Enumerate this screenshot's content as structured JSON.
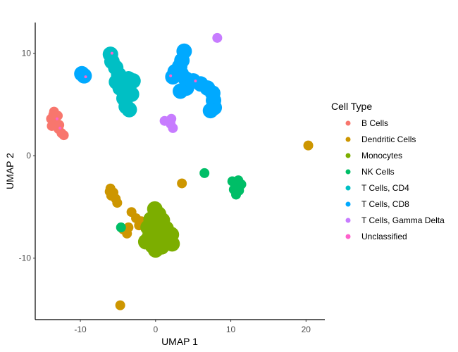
{
  "chart_data": {
    "type": "scatter",
    "title": "",
    "xlabel": "UMAP 1",
    "ylabel": "UMAP 2",
    "xlim": [
      -16,
      22.5
    ],
    "ylim": [
      -16,
      13
    ],
    "xticks": [
      -10,
      0,
      10,
      20
    ],
    "xtick_labels": [
      "-10",
      "0",
      "10",
      "20"
    ],
    "yticks": [
      -10,
      0,
      10
    ],
    "ytick_labels": [
      "-10",
      "0",
      "10"
    ],
    "grid": false,
    "legend": {
      "title": "Cell Type",
      "position": "right",
      "entries": [
        {
          "label": "B Cells",
          "color": "#F8766D"
        },
        {
          "label": "Dendritic Cells",
          "color": "#CD9600"
        },
        {
          "label": "Monocytes",
          "color": "#7CAE00"
        },
        {
          "label": "NK Cells",
          "color": "#00BE67"
        },
        {
          "label": "T Cells, CD4",
          "color": "#00BFC4"
        },
        {
          "label": "T Cells, CD8",
          "color": "#00A9FF"
        },
        {
          "label": "T Cells, Gamma Delta",
          "color": "#C77CFF"
        },
        {
          "label": "Unclassified",
          "color": "#FF61CC"
        }
      ]
    },
    "clusters": [
      {
        "name": "B Cells",
        "color": "#F8766D",
        "points": [
          [
            -13.5,
            4.3
          ],
          [
            -13.9,
            3.6
          ],
          [
            -13.2,
            3.2
          ],
          [
            -13.8,
            2.9
          ],
          [
            -12.9,
            2.6
          ],
          [
            -12.5,
            2.2
          ],
          [
            -12.2,
            2.0
          ],
          [
            -13.0,
            3.9
          ],
          [
            -13.6,
            4.0
          ],
          [
            -12.8,
            3.0
          ]
        ]
      },
      {
        "name": "Dendritic Cells",
        "color": "#CD9600",
        "points": [
          [
            -6.0,
            -3.2
          ],
          [
            -5.6,
            -3.6
          ],
          [
            -5.9,
            -3.9
          ],
          [
            -5.3,
            -4.2
          ],
          [
            -5.1,
            -4.6
          ],
          [
            -6.1,
            -3.5
          ],
          [
            -3.2,
            -5.5
          ],
          [
            -2.6,
            -6.1
          ],
          [
            -2.2,
            -6.8
          ],
          [
            -3.6,
            -7.0
          ],
          [
            -4.3,
            -7.2
          ],
          [
            -3.8,
            -7.6
          ],
          [
            -1.9,
            -6.4
          ],
          [
            -4.7,
            -14.6
          ],
          [
            20.3,
            1.0
          ],
          [
            3.5,
            -2.7
          ]
        ]
      },
      {
        "name": "Monocytes",
        "color": "#7CAE00",
        "points": [
          [
            -0.1,
            -5.2
          ],
          [
            0.4,
            -5.7
          ],
          [
            -0.6,
            -6.2
          ],
          [
            0.9,
            -6.3
          ],
          [
            -1.0,
            -7.0
          ],
          [
            0.2,
            -7.0
          ],
          [
            1.4,
            -7.1
          ],
          [
            2.1,
            -7.7
          ],
          [
            -0.8,
            -7.9
          ],
          [
            0.6,
            -8.0
          ],
          [
            1.6,
            -8.3
          ],
          [
            -0.4,
            -8.8
          ],
          [
            0.8,
            -8.9
          ],
          [
            2.2,
            -8.6
          ],
          [
            -1.3,
            -8.4
          ],
          [
            0.0,
            -9.2
          ]
        ]
      },
      {
        "name": "NK Cells",
        "color": "#00BE67",
        "points": [
          [
            10.2,
            -2.5
          ],
          [
            11.0,
            -2.4
          ],
          [
            10.6,
            -2.9
          ],
          [
            11.4,
            -2.8
          ],
          [
            10.4,
            -3.3
          ],
          [
            11.1,
            -3.4
          ],
          [
            10.7,
            -3.8
          ],
          [
            6.5,
            -1.7
          ],
          [
            -4.6,
            -7.0
          ]
        ]
      },
      {
        "name": "T Cells, CD4",
        "color": "#00BFC4",
        "points": [
          [
            -6.0,
            9.9
          ],
          [
            -5.8,
            9.2
          ],
          [
            -5.3,
            8.6
          ],
          [
            -4.9,
            7.9
          ],
          [
            -5.2,
            7.2
          ],
          [
            -4.4,
            7.0
          ],
          [
            -3.6,
            7.5
          ],
          [
            -3.0,
            7.3
          ],
          [
            -4.7,
            6.6
          ],
          [
            -3.8,
            6.3
          ],
          [
            -3.2,
            6.0
          ],
          [
            -4.2,
            5.6
          ],
          [
            -3.9,
            4.8
          ],
          [
            -3.5,
            4.5
          ]
        ]
      },
      {
        "name": "T Cells, CD8",
        "color": "#00A9FF",
        "points": [
          [
            3.8,
            10.2
          ],
          [
            3.5,
            9.3
          ],
          [
            3.2,
            8.7
          ],
          [
            2.6,
            8.2
          ],
          [
            3.4,
            8.0
          ],
          [
            2.3,
            7.7
          ],
          [
            4.0,
            7.5
          ],
          [
            5.0,
            7.3
          ],
          [
            6.0,
            7.0
          ],
          [
            4.1,
            6.6
          ],
          [
            6.9,
            6.6
          ],
          [
            3.3,
            6.3
          ],
          [
            7.6,
            6.1
          ],
          [
            7.7,
            5.4
          ],
          [
            7.8,
            4.7
          ],
          [
            7.3,
            4.4
          ],
          [
            -9.8,
            8.0
          ],
          [
            -9.5,
            7.8
          ]
        ]
      },
      {
        "name": "T Cells, Gamma Delta",
        "color": "#C77CFF",
        "points": [
          [
            2.1,
            3.6
          ],
          [
            2.0,
            3.1
          ],
          [
            2.3,
            2.7
          ],
          [
            1.2,
            3.4
          ],
          [
            8.2,
            11.5
          ]
        ]
      },
      {
        "name": "Unclassified",
        "color": "#FF61CC",
        "points": [
          [
            2.0,
            7.8
          ],
          [
            5.3,
            7.3
          ],
          [
            -5.8,
            10.0
          ],
          [
            -9.3,
            7.7
          ],
          [
            -13.1,
            3.6
          ],
          [
            -12.7,
            2.7
          ]
        ]
      }
    ]
  }
}
